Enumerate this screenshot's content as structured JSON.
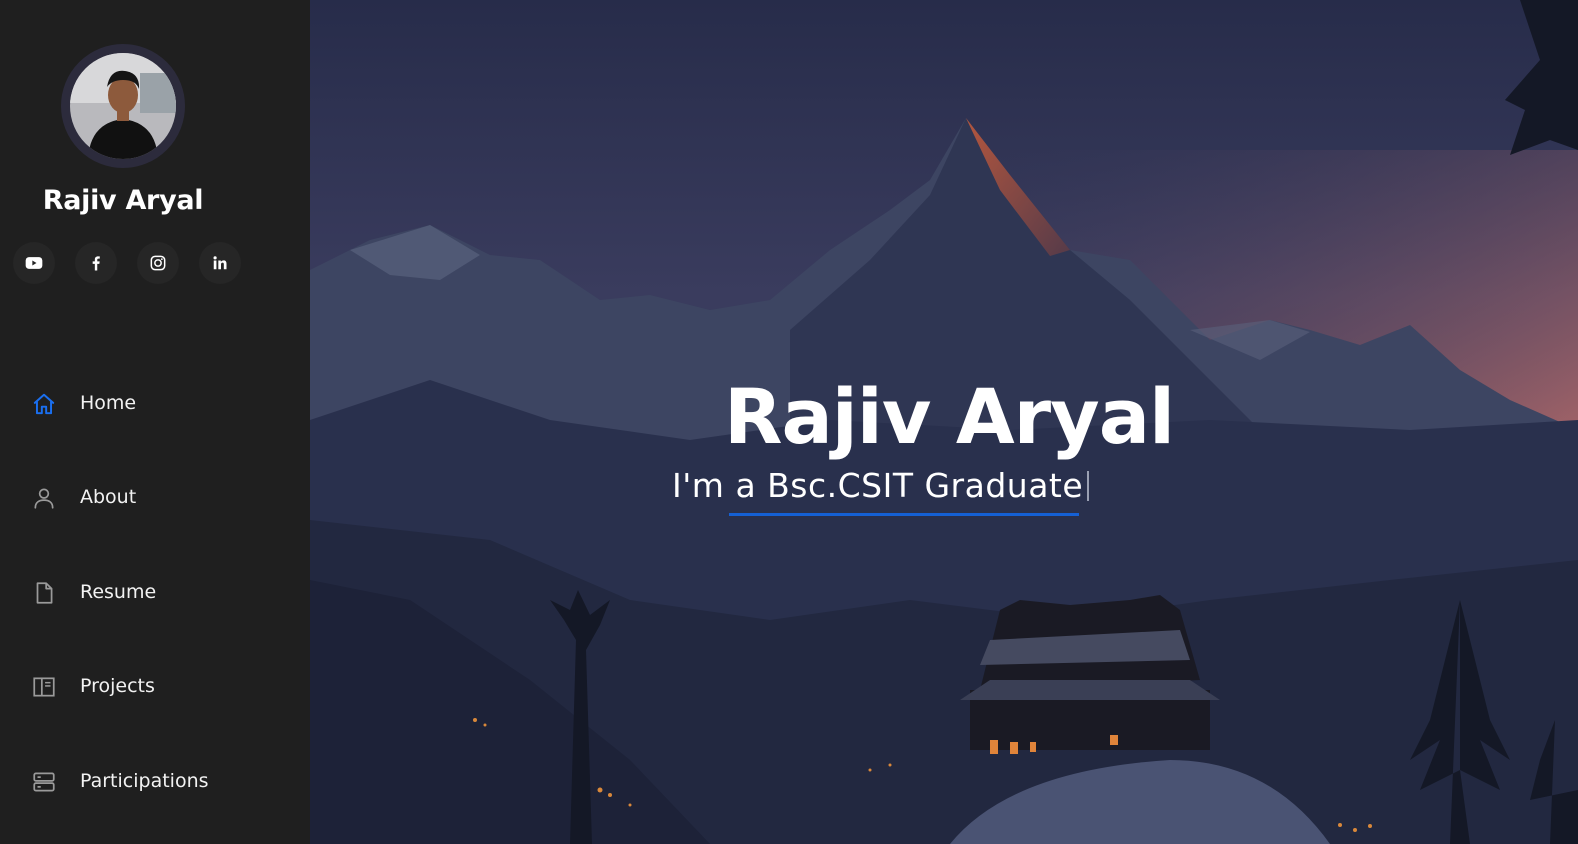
{
  "profile": {
    "name": "Rajiv Aryal"
  },
  "social_links": [
    {
      "icon": "youtube-icon"
    },
    {
      "icon": "facebook-icon"
    },
    {
      "icon": "instagram-icon"
    },
    {
      "icon": "linkedin-icon"
    }
  ],
  "nav": {
    "items": [
      {
        "label": "Home",
        "icon": "home-icon",
        "active": true
      },
      {
        "label": "About",
        "icon": "person-icon",
        "active": false
      },
      {
        "label": "Resume",
        "icon": "file-icon",
        "active": false
      },
      {
        "label": "Projects",
        "icon": "book-icon",
        "active": false
      },
      {
        "label": "Participations",
        "icon": "server-icon",
        "active": false
      }
    ]
  },
  "hero": {
    "title": "Rajiv Aryal",
    "subtitle": "I'm a Bsc.CSIT Graduate"
  },
  "colors": {
    "sidebar_bg": "#1f1f1f",
    "accent": "#1560d4",
    "icon_gray": "#9a9a9a",
    "text": "#ffffff"
  }
}
